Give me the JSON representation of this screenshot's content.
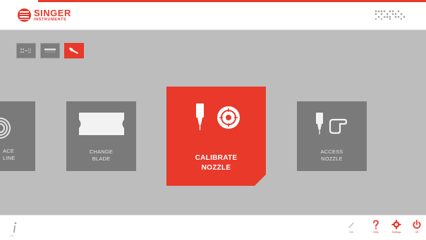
{
  "header": {
    "logo_line1": "SINGER",
    "logo_line2": "INSTRUMENTS"
  },
  "tabs": [
    {
      "icon": "grid-transfer-icon",
      "active": false
    },
    {
      "icon": "blade-icon",
      "active": false
    },
    {
      "icon": "wrench-icon",
      "active": true
    }
  ],
  "cards": {
    "left_partial": {
      "label": "ACE\nLINE",
      "icon": "spiral-icon"
    },
    "change_blade": {
      "label": "CHANGE\nBLADE",
      "icon": "blade-icon"
    },
    "calibrate_nozzle": {
      "label": "CALIBRATE\nNOZZLE",
      "icon": "nozzle-target-icon"
    },
    "access_nozzle": {
      "label": "ACCESS\nNOZZLE",
      "icon": "nozzle-hand-icon"
    }
  },
  "footer": {
    "info_label": "Info",
    "edit_label": "Edit",
    "help_label": "Help",
    "settings_label": "Settings",
    "off_label": "Off"
  },
  "colors": {
    "accent": "#e8392b",
    "card_grey": "#7a7a7a",
    "background": "#bdbdbd"
  }
}
